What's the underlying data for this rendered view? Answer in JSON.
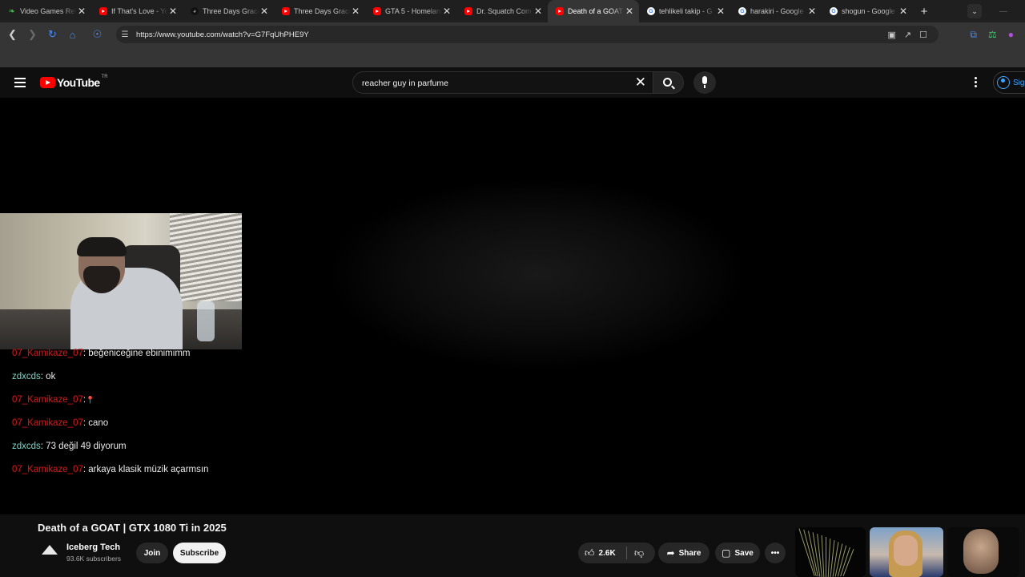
{
  "browser": {
    "tabs": [
      {
        "title": "Video Games Rev",
        "icon": "green-leaf-icon"
      },
      {
        "title": "If That's Love - Yo",
        "icon": "youtube-icon"
      },
      {
        "title": "Three Days Grace",
        "icon": "dark-icon"
      },
      {
        "title": "Three Days Grace",
        "icon": "youtube-icon"
      },
      {
        "title": "GTA 5 - Homeland",
        "icon": "youtube-icon"
      },
      {
        "title": "Dr. Squatch Com",
        "icon": "youtube-icon"
      },
      {
        "title": "Death of a GOAT",
        "icon": "youtube-icon",
        "active": true
      },
      {
        "title": "tehlikeli takip - G",
        "icon": "google-icon"
      },
      {
        "title": "harakiri - Google",
        "icon": "google-icon"
      },
      {
        "title": "shogun - Google",
        "icon": "google-icon"
      }
    ],
    "url": "https://www.youtube.com/watch?v=G7FqUhPHE9Y"
  },
  "youtube": {
    "logo_text": "YouTube",
    "country_code": "TR",
    "search_query": "reacher guy in parfume",
    "signin_label": "Sig"
  },
  "chat": {
    "messages": [
      {
        "user": "07_Kamikaze_07",
        "text": ": beğeniceğine ebinimimm",
        "color": "red"
      },
      {
        "user": "zdxcds",
        "text": ": ok",
        "color": "teal"
      },
      {
        "user": "07_Kamikaze_07",
        "text": ":",
        "color": "red",
        "emoji": "📍"
      },
      {
        "user": "07_Kamikaze_07",
        "text": ": cano",
        "color": "red"
      },
      {
        "user": "zdxcds",
        "text": ": 73 değil 49 diyorum",
        "color": "teal"
      },
      {
        "user": "07_Kamikaze_07",
        "text": ": arkaya klasik müzik açarmsın",
        "color": "red"
      }
    ]
  },
  "video": {
    "title": "Death of a GOAT | GTX 1080 Ti in 2025",
    "channel": "Iceberg Tech",
    "subscribers": "93.6K subscribers",
    "join_label": "Join",
    "subscribe_label": "Subscribe",
    "likes": "2.6K",
    "share_label": "Share",
    "save_label": "Save"
  },
  "colors": {
    "youtube_red": "#ff0000",
    "chat_user_red": "#c01a1a",
    "chat_user_teal": "#7dd3c5"
  }
}
